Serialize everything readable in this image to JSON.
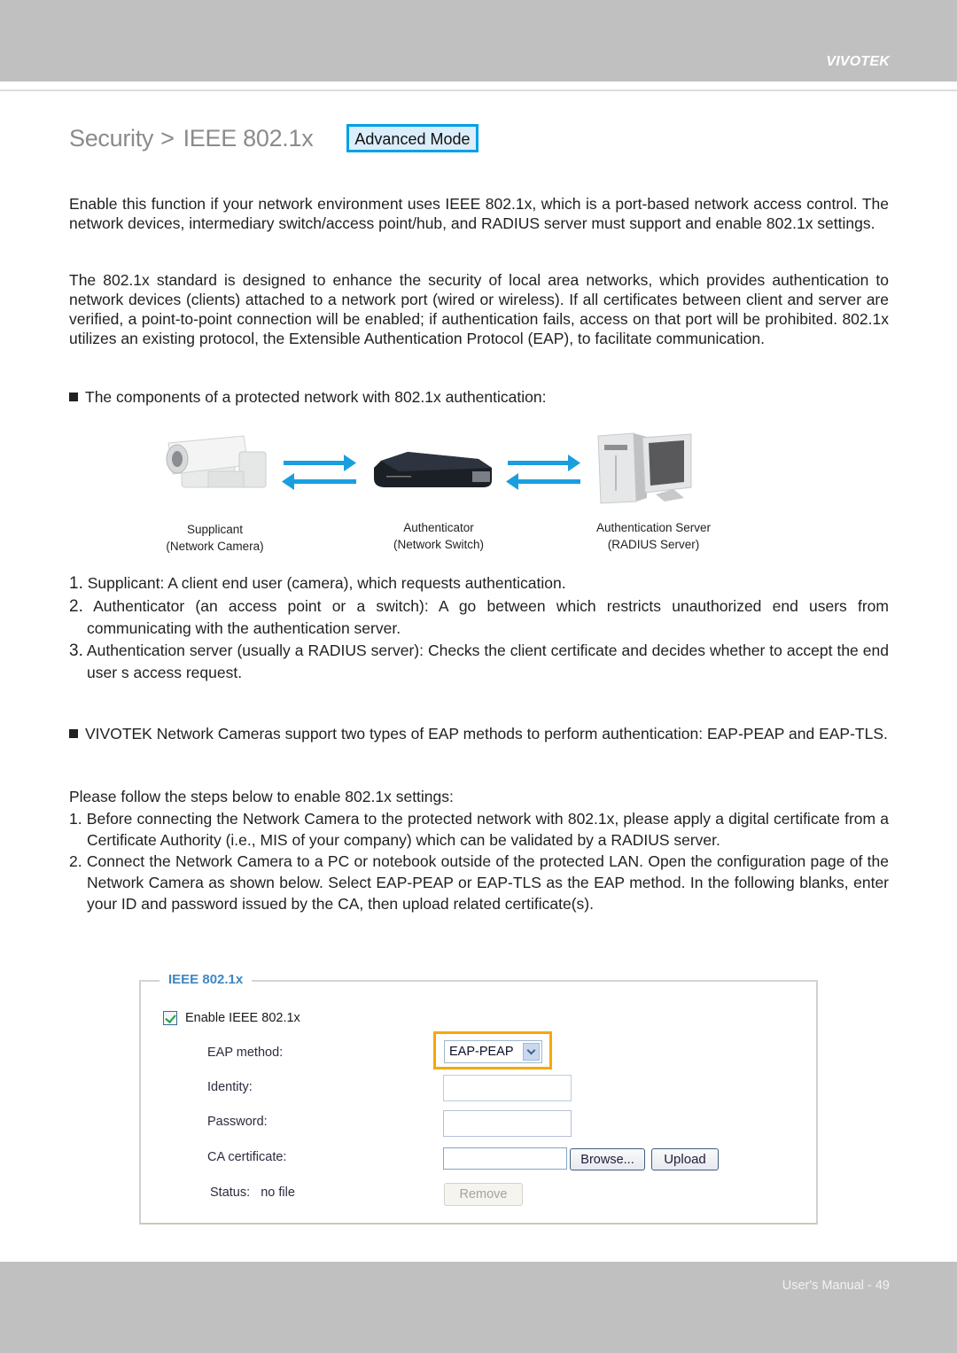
{
  "header": {
    "brand": "VIVOTEK"
  },
  "title": {
    "section": "Security",
    "separator": ">",
    "page": "IEEE 802.1x",
    "mode_button": "Advanced Mode"
  },
  "body": {
    "intro_1": "Enable this function if your network environment uses IEEE 802.1x, which is a port-based network access control. The network devices, intermediary switch/access point/hub, and RADIUS server must support and enable 802.1x settings.",
    "intro_2": "The 802.1x standard is designed to enhance the security of local area networks, which provides authentication to network devices (clients) attached to a network port (wired or wireless). If all certificates between client and server are verified, a point-to-point connection will be enabled; if authentication fails, access on that port will be prohibited. 802.1x utilizes an existing protocol, the Extensible Authentication Protocol (EAP), to facilitate communication.",
    "components_heading": "The components of a protected network with 802.1x authentication:",
    "diagram": {
      "devices": [
        {
          "name": "Supplicant",
          "sub": "(Network Camera)"
        },
        {
          "name": "Authenticator",
          "sub": "(Network Switch)"
        },
        {
          "name": "Authentication Server",
          "sub": "(RADIUS Server)"
        }
      ],
      "arrow_color": "#1a9ee0"
    },
    "components": [
      {
        "num": "1.",
        "text": "Supplicant: A client end user (camera), which requests authentication."
      },
      {
        "num": "2.",
        "text": "Authenticator (an access point or a switch): A  go between  which restricts unauthorized end users from communicating with the authentication server."
      },
      {
        "num": "3.",
        "text": "Authentication server (usually a RADIUS server): Checks the client certificate and decides whether to accept the end user s access request."
      }
    ],
    "eap_note": "VIVOTEK Network Cameras support two types of EAP methods to perform authentication: EAP-PEAP and EAP-TLS.",
    "steps_intro": "Please follow the steps below to enable 802.1x settings:",
    "steps": [
      {
        "num": "1.",
        "text": "Before connecting the Network Camera to the protected network with 802.1x, please apply a digital certificate from a Certificate Authority (i.e., MIS of your company) which can be validated by a RADIUS server."
      },
      {
        "num": "2.",
        "text": "Connect the Network Camera to a PC or notebook outside of the protected LAN. Open the configuration page of the Network Camera as shown below. Select EAP-PEAP or EAP-TLS as the EAP method. In the following blanks, enter your ID and password issued by the CA, then upload related certificate(s)."
      }
    ]
  },
  "form": {
    "legend": "IEEE 802.1x",
    "enable_label": "Enable IEEE 802.1x",
    "enable_checked": true,
    "eap_method_label": "EAP method:",
    "eap_method_value": "EAP-PEAP",
    "identity_label": "Identity:",
    "identity_value": "",
    "password_label": "Password:",
    "password_value": "",
    "ca_label": "CA certificate:",
    "ca_value": "",
    "browse_button": "Browse...",
    "upload_button": "Upload",
    "status_label": "Status:",
    "status_value": "no file",
    "remove_button": "Remove",
    "highlight_color": "#f5a800"
  },
  "footer": {
    "page_label": "User's Manual - 49"
  }
}
